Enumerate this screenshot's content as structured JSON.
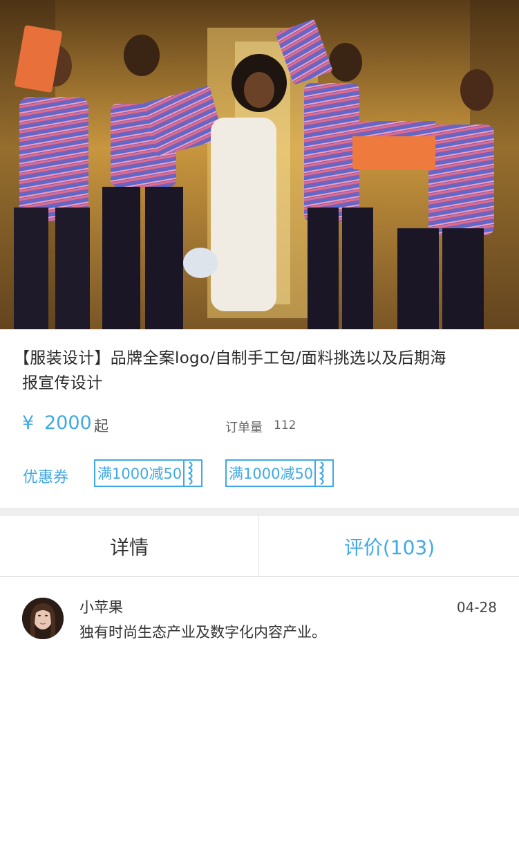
{
  "product": {
    "title_line1": "【服装设计】品牌全案logo/自制手工包/面料挑选以及后期海",
    "title_line2": "报宣传设计",
    "price_symbol": "¥",
    "price": "2000",
    "price_unit": "起",
    "orders_label": "订单量",
    "orders_count": "112"
  },
  "coupons": {
    "label": "优惠券",
    "items": [
      {
        "text": "满1000减50"
      },
      {
        "text": "满1000减50"
      }
    ]
  },
  "tabs": {
    "details": "详情",
    "reviews": "评价(103)",
    "active": "reviews"
  },
  "reviews": [
    {
      "user": "小苹果",
      "date": "04-28",
      "text": "独有时尚生态产业及数字化内容产业。"
    }
  ],
  "colors": {
    "accent": "#3fa9e6",
    "text": "#333333",
    "divider": "#eeeeee"
  },
  "icons": {
    "hero": "product-photo-image",
    "avatar": "user-avatar-image",
    "coupon_stub": "coupon-perforation-icon"
  }
}
